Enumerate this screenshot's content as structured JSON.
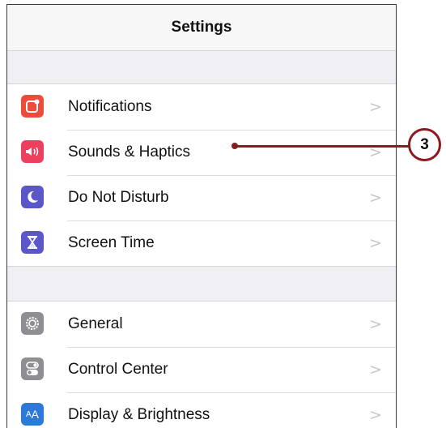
{
  "header": {
    "title": "Settings"
  },
  "groups": [
    {
      "items": [
        {
          "label": "Notifications",
          "icon": "notifications-icon",
          "icon_color": "#ef4b3c"
        },
        {
          "label": "Sounds & Haptics",
          "icon": "speaker-icon",
          "icon_color": "#ef3f5f"
        },
        {
          "label": "Do Not Disturb",
          "icon": "moon-icon",
          "icon_color": "#5b57c8"
        },
        {
          "label": "Screen Time",
          "icon": "hourglass-icon",
          "icon_color": "#5b57c8"
        }
      ]
    },
    {
      "items": [
        {
          "label": "General",
          "icon": "gear-icon",
          "icon_color": "#8e8e93"
        },
        {
          "label": "Control Center",
          "icon": "toggles-icon",
          "icon_color": "#8e8e93"
        },
        {
          "label": "Display & Brightness",
          "icon": "text-size-icon",
          "icon_color": "#2d7ad6",
          "icon_text": "AA"
        }
      ]
    }
  ],
  "chevron": ">",
  "callout": {
    "number": "3",
    "color": "#8b1a1f"
  }
}
